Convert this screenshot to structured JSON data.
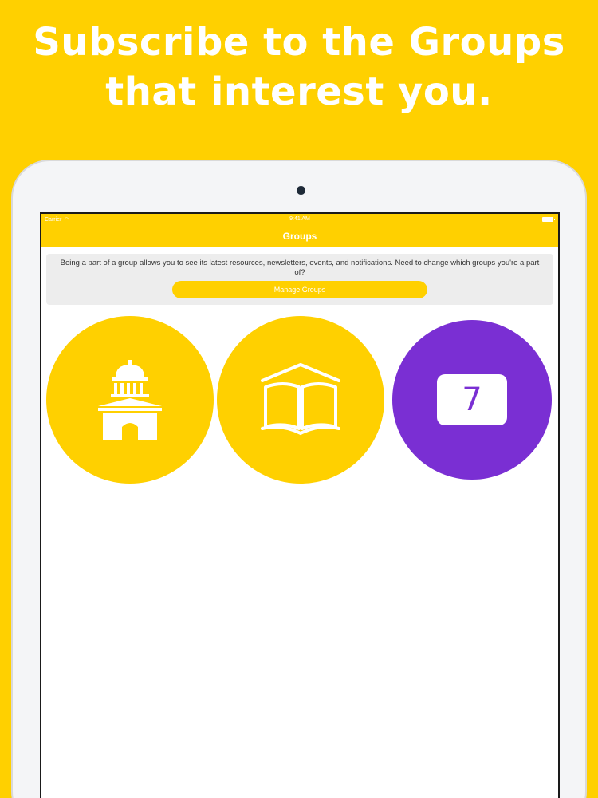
{
  "headline": {
    "line1": "Subscribe to the Groups",
    "line2": "that interest you."
  },
  "status_bar": {
    "carrier": "Carrier",
    "time": "9:41 AM"
  },
  "nav": {
    "title": "Groups"
  },
  "banner": {
    "text": "Being a part of a group allows you to see its latest resources, newsletters, events, and notifications. Need to change which groups you're a part of?",
    "button_label": "Manage Groups"
  },
  "groups": [
    {
      "icon": "capitol-building-icon",
      "color": "#FFD000"
    },
    {
      "icon": "open-book-icon",
      "color": "#FFD000"
    },
    {
      "icon": "calendar-icon",
      "color": "#7A2FD3",
      "badge": "7"
    }
  ],
  "colors": {
    "accent": "#FFD000",
    "purple": "#7A2FD3",
    "banner_bg": "#EDEDED"
  }
}
